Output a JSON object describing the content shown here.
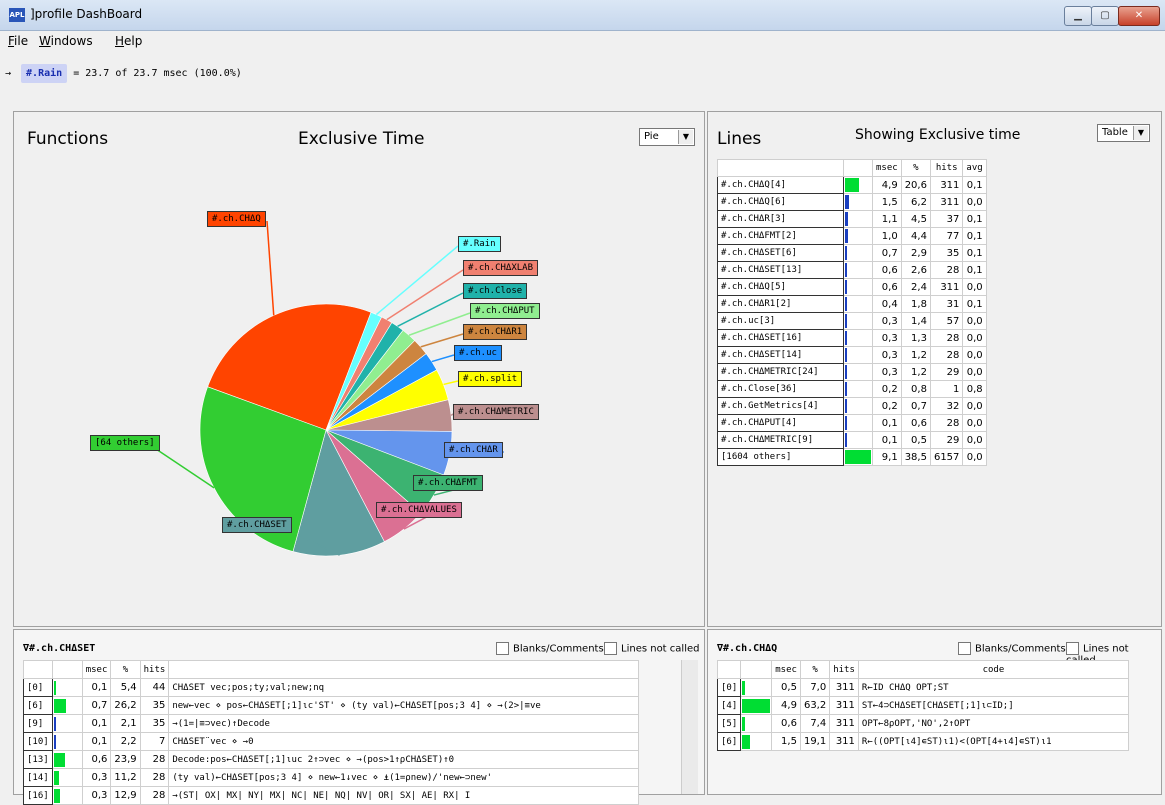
{
  "window": {
    "title": "]profile DashBoard",
    "icon": "apl-icon"
  },
  "menu": [
    {
      "label": "File",
      "u": "F",
      "rest": "ile"
    },
    {
      "label": "Windows",
      "u": "W",
      "rest": "indows"
    },
    {
      "label": "Help",
      "u": "H",
      "rest": "elp"
    }
  ],
  "breadcrumb": {
    "arrow": "→",
    "chip": "#.Rain",
    "text": "= 23.7 of 23.7 msec (100.0%)"
  },
  "functions": {
    "title": "Functions",
    "subtitle": "Exclusive Time",
    "view": "Pie"
  },
  "chart_data": {
    "type": "pie",
    "title": "Exclusive Time",
    "slices": [
      {
        "label": "#.ch.CHΔQ",
        "value": 20.6,
        "color": "#ff4400"
      },
      {
        "label": "#.Rain",
        "value": 1.2,
        "color": "#66ffff"
      },
      {
        "label": "#.ch.CHΔXLAB",
        "value": 1.2,
        "color": "#f08070"
      },
      {
        "label": "#.ch.Close",
        "value": 1.4,
        "color": "#20b2aa"
      },
      {
        "label": "#.ch.CHΔPUT",
        "value": 1.6,
        "color": "#90ee90"
      },
      {
        "label": "#.ch.CHΔR1",
        "value": 1.8,
        "color": "#cd853f"
      },
      {
        "label": "#.ch.uc",
        "value": 2.0,
        "color": "#1e90ff"
      },
      {
        "label": "#.ch.split",
        "value": 3.3,
        "color": "#ffff00"
      },
      {
        "label": "#.ch.CHΔMETRIC",
        "value": 3.3,
        "color": "#bc8f8f"
      },
      {
        "label": "#.ch.CHΔR",
        "value": 4.6,
        "color": "#6495ed"
      },
      {
        "label": "#.ch.CHΔFMT",
        "value": 4.6,
        "color": "#3cb371"
      },
      {
        "label": "#.ch.CHΔVALUES",
        "value": 4.8,
        "color": "#db7093"
      },
      {
        "label": "#.ch.CHΔSET",
        "value": 9.7,
        "color": "#5f9ea0"
      },
      {
        "label": "[64 others]",
        "value": 21.5,
        "color": "#32cd32"
      }
    ]
  },
  "lines": {
    "title": "Lines",
    "subtitle": "Showing Exclusive time",
    "view": "Table",
    "headers": [
      "",
      "",
      "msec",
      "%",
      "hits",
      "avg"
    ],
    "rows": [
      {
        "name": "#.ch.CHΔQ[4]",
        "pct": 20.6,
        "msec": "4,9",
        "p": "20,6",
        "hits": "311",
        "avg": "0,1"
      },
      {
        "name": "#.ch.CHΔQ[6]",
        "pct": 6.2,
        "msec": "1,5",
        "p": "6,2",
        "hits": "311",
        "avg": "0,0"
      },
      {
        "name": "#.ch.CHΔR[3]",
        "pct": 4.5,
        "msec": "1,1",
        "p": "4,5",
        "hits": "37",
        "avg": "0,1"
      },
      {
        "name": "#.ch.CHΔFMT[2]",
        "pct": 4.4,
        "msec": "1,0",
        "p": "4,4",
        "hits": "77",
        "avg": "0,1"
      },
      {
        "name": "#.ch.CHΔSET[6]",
        "pct": 2.9,
        "msec": "0,7",
        "p": "2,9",
        "hits": "35",
        "avg": "0,1"
      },
      {
        "name": "#.ch.CHΔSET[13]",
        "pct": 2.6,
        "msec": "0,6",
        "p": "2,6",
        "hits": "28",
        "avg": "0,1"
      },
      {
        "name": "#.ch.CHΔQ[5]",
        "pct": 2.4,
        "msec": "0,6",
        "p": "2,4",
        "hits": "311",
        "avg": "0,0"
      },
      {
        "name": "#.ch.CHΔR1[2]",
        "pct": 1.8,
        "msec": "0,4",
        "p": "1,8",
        "hits": "31",
        "avg": "0,1"
      },
      {
        "name": "#.ch.uc[3]",
        "pct": 1.4,
        "msec": "0,3",
        "p": "1,4",
        "hits": "57",
        "avg": "0,0"
      },
      {
        "name": "#.ch.CHΔSET[16]",
        "pct": 1.3,
        "msec": "0,3",
        "p": "1,3",
        "hits": "28",
        "avg": "0,0"
      },
      {
        "name": "#.ch.CHΔSET[14]",
        "pct": 1.2,
        "msec": "0,3",
        "p": "1,2",
        "hits": "28",
        "avg": "0,0"
      },
      {
        "name": "#.ch.CHΔMETRIC[24]",
        "pct": 1.2,
        "msec": "0,3",
        "p": "1,2",
        "hits": "29",
        "avg": "0,0"
      },
      {
        "name": "#.ch.Close[36]",
        "pct": 0.8,
        "msec": "0,2",
        "p": "0,8",
        "hits": "1",
        "avg": "0,8"
      },
      {
        "name": "#.ch.GetMetrics[4]",
        "pct": 0.7,
        "msec": "0,2",
        "p": "0,7",
        "hits": "32",
        "avg": "0,0"
      },
      {
        "name": "#.ch.CHΔPUT[4]",
        "pct": 0.6,
        "msec": "0,1",
        "p": "0,6",
        "hits": "28",
        "avg": "0,0"
      },
      {
        "name": "#.ch.CHΔMETRIC[9]",
        "pct": 0.5,
        "msec": "0,1",
        "p": "0,5",
        "hits": "29",
        "avg": "0,0"
      },
      {
        "name": "[1604 others]",
        "pct": 38.5,
        "msec": "9,1",
        "p": "38,5",
        "hits": "6157",
        "avg": "0,0"
      }
    ]
  },
  "code1": {
    "title": "∇#.ch.CHΔSET",
    "blanks_label": "Blanks/Comments",
    "notcalled_label": "Lines not called",
    "headers": [
      "",
      "",
      "msec",
      "%",
      "hits",
      ""
    ],
    "rows": [
      {
        "ln": "[0]",
        "pct": 5.4,
        "msec": "0,1",
        "p": "5,4",
        "hits": "44",
        "code": "CHΔSET vec;pos;ty;val;new;nq"
      },
      {
        "ln": "[6]",
        "pct": 26.2,
        "msec": "0,7",
        "p": "26,2",
        "hits": "35",
        "code": "new←vec ⋄ pos←CHΔSET[;1]⍳c'ST' ⋄ (ty val)←CHΔSET[pos;3 4] ⋄ →(2>|≡ve"
      },
      {
        "ln": "[9]",
        "pct": 2.1,
        "msec": "0,1",
        "p": "2,1",
        "hits": "35",
        "code": "→(1=|≡⊃vec)↑Decode"
      },
      {
        "ln": "[10]",
        "pct": 2.2,
        "msec": "0,1",
        "p": "2,2",
        "hits": "7",
        "code": "CHΔSET¨vec ⋄ →0"
      },
      {
        "ln": "[13]",
        "pct": 23.9,
        "msec": "0,6",
        "p": "23,9",
        "hits": "28",
        "code": "Decode:pos←CHΔSET[;1]⍳uc 2↑⊃vec ⋄ →(pos>1↑⍴CHΔSET)↑0"
      },
      {
        "ln": "[14]",
        "pct": 11.2,
        "msec": "0,3",
        "p": "11,2",
        "hits": "28",
        "code": "(ty val)←CHΔSET[pos;3 4] ⋄ new←1↓vec ⋄ ⍎(1=⍴new)/'new←⊃new'"
      },
      {
        "ln": "[16]",
        "pct": 12.9,
        "msec": "0,3",
        "p": "12,9",
        "hits": "28",
        "code": "→(ST| OX| MX| NY| MX| NC| NE| NQ| NV| OR| SX| AE| RX| I"
      }
    ]
  },
  "code2": {
    "title": "∇#.ch.CHΔQ",
    "blanks_label": "Blanks/Comments",
    "notcalled_label": "Lines not called",
    "headers": [
      "",
      "",
      "msec",
      "%",
      "hits",
      "code"
    ],
    "rows": [
      {
        "ln": "[0]",
        "pct": 7.0,
        "msec": "0,5",
        "p": "7,0",
        "hits": "311",
        "code": "R←ID CHΔQ OPT;ST"
      },
      {
        "ln": "[4]",
        "pct": 63.2,
        "msec": "4,9",
        "p": "63,2",
        "hits": "311",
        "code": "ST←4⊃CHΔSET[CHΔSET[;1]⍳⊂ID;]"
      },
      {
        "ln": "[5]",
        "pct": 7.4,
        "msec": "0,6",
        "p": "7,4",
        "hits": "311",
        "code": "OPT←8⍴OPT,'NO',2↑OPT"
      },
      {
        "ln": "[6]",
        "pct": 19.1,
        "msec": "1,5",
        "p": "19,1",
        "hits": "311",
        "code": "R←((OPT[⍳4]∊ST)⍳1)<(OPT[4+⍳4]∊ST)⍳1"
      }
    ]
  }
}
